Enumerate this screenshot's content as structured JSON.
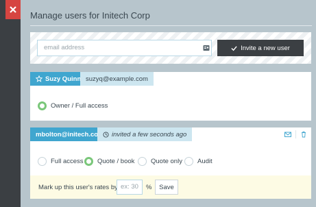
{
  "modal": {
    "title": "Manage users for Initech Corp"
  },
  "invite": {
    "email_placeholder": "email address",
    "button_label": "Invite a new user"
  },
  "users": [
    {
      "name": "Suzy Quinn",
      "email": "suzyq@example.com",
      "options": [
        {
          "label": "Owner / Full access",
          "selected": true
        }
      ]
    },
    {
      "email": "mbolton@initech.com",
      "status": "invited a few seconds ago",
      "options": [
        {
          "label": "Full access",
          "selected": false
        },
        {
          "label": "Quote / book",
          "selected": true
        },
        {
          "label": "Quote only",
          "selected": false
        },
        {
          "label": "Audit",
          "selected": false
        }
      ],
      "markup": {
        "label": "Mark up this user's rates by",
        "placeholder": "ex: 30",
        "unit": "%",
        "save_label": "Save"
      }
    }
  ],
  "colors": {
    "accent": "#40a6cf",
    "close": "#d64541",
    "dark_button": "#3b3f43",
    "radio_selected": "#7ac77a"
  }
}
